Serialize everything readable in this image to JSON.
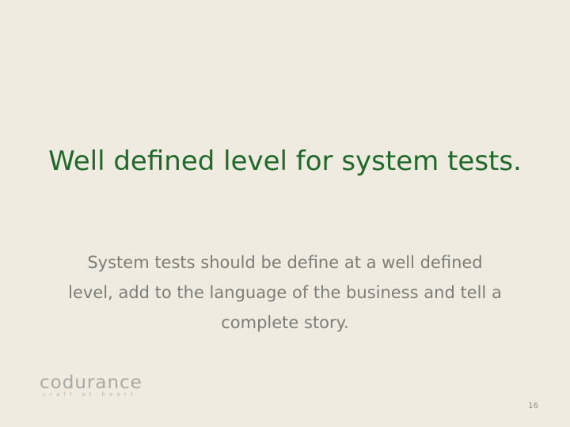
{
  "slide": {
    "title": "Well defined level for system tests.",
    "body": "System tests should be define at a well defined level, add to the language of the business and tell a complete story.",
    "number": "16"
  },
  "logo": {
    "wordmark": "codurance",
    "tagline": "craft at heart",
    "colors": {
      "text": "#a9a9a3",
      "ring": "#c7c7c0",
      "accent": "#e08a3a"
    }
  },
  "colors": {
    "background": "#efebe0",
    "title": "#1f6a2a",
    "body": "#7d7d77"
  }
}
